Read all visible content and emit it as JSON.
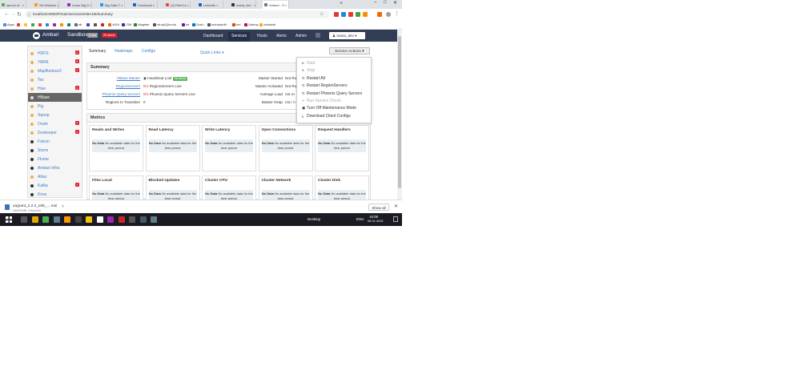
{
  "browser": {
    "tabs": [
      {
        "label": "launch of · ×",
        "color": "#4caf50"
      },
      {
        "label": "Set Maximu ×",
        "color": "#ff9800"
      },
      {
        "label": "Learn Big D ×",
        "color": "#9c27b0"
      },
      {
        "label": "Big Data T ×",
        "color": "#2196f3"
      },
      {
        "label": "Download ×",
        "color": "#1565c0"
      },
      {
        "label": "(3) FilterCo ×",
        "color": "#f44336"
      },
      {
        "label": "LinkedIn ×",
        "color": "#0a66c2"
      },
      {
        "label": "maria_dev · ×",
        "color": "#333333"
      },
      {
        "label": "Ambari - S ×",
        "color": "#607d8b"
      }
    ],
    "new_tab": "+",
    "window_controls": [
      "–",
      "□",
      "✕"
    ],
    "url": "localhost:8080/#/main/services/HBASE/summary",
    "bookmarks": [
      {
        "label": "Apps",
        "color": "#4285f4"
      },
      {
        "label": "",
        "color": "#e53935"
      },
      {
        "label": "",
        "color": "#fbc02d"
      },
      {
        "label": "",
        "color": "#43a047"
      },
      {
        "label": "",
        "color": "#e53935"
      },
      {
        "label": "",
        "color": "#1e88e5"
      },
      {
        "label": "",
        "color": "#8e24aa"
      },
      {
        "label": "",
        "color": "#fb8c00"
      },
      {
        "label": "",
        "color": "#00897b"
      },
      {
        "label": "alt",
        "color": "#546e7a"
      },
      {
        "label": "",
        "color": "#3949ab"
      },
      {
        "label": "",
        "color": "#6d4c41"
      },
      {
        "label": "",
        "color": "#c62828"
      },
      {
        "label": "4004",
        "color": "#ef6c00"
      },
      {
        "label": "ZIM",
        "color": "#283593"
      },
      {
        "label": "Magster",
        "color": "#2e7d32"
      },
      {
        "label": "study/Qhrvdu",
        "color": "#555555"
      },
      {
        "label": "ne",
        "color": "#6a1b9a"
      },
      {
        "label": "Gortu",
        "color": "#0277bd"
      },
      {
        "label": "wordpardit",
        "color": "#455a64"
      },
      {
        "label": "net",
        "color": "#d84315"
      },
      {
        "label": "Udemy",
        "color": "#ad1457"
      },
      {
        "label": "ebooksit",
        "color": "#f9a825"
      }
    ]
  },
  "ambari": {
    "brand": "Ambari",
    "cluster": "Sandbox",
    "ops_badge": "0 ops",
    "alerts_badge": "29 alerts",
    "nav": [
      "Dashboard",
      "Services",
      "Hosts",
      "Alerts",
      "Admin"
    ],
    "user": "maria_dev ▾"
  },
  "sidebar": {
    "items": [
      {
        "label": "HDFS",
        "status": "#f0ad4e",
        "count": "2"
      },
      {
        "label": "YARN",
        "status": "#f0ad4e",
        "count": "5"
      },
      {
        "label": "MapReduce2",
        "status": "#f0ad4e",
        "count": "2"
      },
      {
        "label": "Tez",
        "status": "#f0ad4e",
        "count": ""
      },
      {
        "label": "Hive",
        "status": "#f0ad4e",
        "count": "3"
      },
      {
        "label": "HBase",
        "status": "#dddddd",
        "count": ""
      },
      {
        "label": "Pig",
        "status": "#f0ad4e",
        "count": ""
      },
      {
        "label": "Sqoop",
        "status": "#f0ad4e",
        "count": ""
      },
      {
        "label": "Oozie",
        "status": "#f0ad4e",
        "count": "2"
      },
      {
        "label": "Zookeeper",
        "status": "#f0ad4e",
        "count": "2"
      },
      {
        "label": "Falcon",
        "status": "#333333",
        "count": ""
      },
      {
        "label": "Storm",
        "status": "#333333",
        "count": ""
      },
      {
        "label": "Flume",
        "status": "#333333",
        "count": ""
      },
      {
        "label": "Ambari Infra",
        "status": "#333333",
        "count": ""
      },
      {
        "label": "Atlas",
        "status": "#f0ad4e",
        "count": ""
      },
      {
        "label": "Kafka",
        "status": "#333333",
        "count": "1"
      },
      {
        "label": "Knox",
        "status": "#333333",
        "count": ""
      }
    ]
  },
  "main": {
    "subtabs": [
      "Summary",
      "Heatmaps",
      "Configs"
    ],
    "quick_links": "Quick Links ▾",
    "service_actions": "Service Actions ▾",
    "summary_title": "Summary",
    "summary_left": [
      {
        "label": "HBase Master",
        "prefix": "",
        "value": "Heartbeat Lost",
        "badge": "No alerts"
      },
      {
        "label": "RegionServers",
        "prefix": "0/1",
        "value": "RegionServers Live",
        "badge": ""
      },
      {
        "label": "Phoenix Query Servers",
        "prefix": "0/1",
        "value": "Phoenix Query Servers Live",
        "badge": ""
      },
      {
        "label": "Regions In Transition",
        "prefix": "",
        "value": "0",
        "badge": ""
      }
    ],
    "summary_right": [
      {
        "label": "Master Started",
        "value": "Not Ru"
      },
      {
        "label": "Master Activated",
        "value": "Not Ru"
      },
      {
        "label": "Average Load",
        "value": "n/a re"
      },
      {
        "label": "Master Heap",
        "value": "n/a / n"
      }
    ],
    "metrics_title": "Metrics",
    "no_data": "No Data",
    "no_data_text": "No available data for the time period",
    "metrics_row1": [
      "Reads and Writes",
      "Read Latency",
      "Write Latency",
      "Open Connections",
      "Request Handlers"
    ],
    "metrics_row2": [
      "Files Local",
      "Blocked Updates",
      "Cluster CPU",
      "Cluster Network",
      "Cluster Disk"
    ]
  },
  "dropdown": {
    "items": [
      {
        "glyph": "▶",
        "label": "Start",
        "disabled": true
      },
      {
        "glyph": "■",
        "label": "Stop",
        "disabled": true
      },
      {
        "glyph": "↻",
        "label": "Restart All",
        "disabled": false
      },
      {
        "glyph": "↻",
        "label": "Restart RegionServers",
        "disabled": false
      },
      {
        "glyph": "↻",
        "label": "Restart Phoenix Query Servers",
        "disabled": false
      },
      {
        "glyph": "✔",
        "label": "Run Service Check",
        "disabled": true
      },
      {
        "glyph": "▣",
        "label": "Turn Off Maintenance Mode",
        "disabled": false
      },
      {
        "glyph": "⤓",
        "label": "Download Client Configs",
        "disabled": false
      }
    ]
  },
  "download": {
    "file": "vagrant_2.2.2_x86_....msi",
    "sub": "226/229 MB, 3 hours left",
    "show_all": "Show all",
    "close": "✕"
  },
  "taskbar": {
    "desktop": "Desktop",
    "lang": "ENG",
    "time": "16:08",
    "date": "06-01-2019",
    "icons": [
      "#555555",
      "#e0a800",
      "#4caf50",
      "#607d8b",
      "#ff9800",
      "#444444",
      "#f4c20d",
      "#ffffff",
      "#9c27b0",
      "#c62828",
      "#555555",
      "#455a64",
      "#607d8b"
    ]
  },
  "colors": {
    "ambari_nav": "#313d54",
    "link": "#3a7ec7",
    "alert_red": "#e0212b",
    "ok_green": "#5cb85c"
  }
}
